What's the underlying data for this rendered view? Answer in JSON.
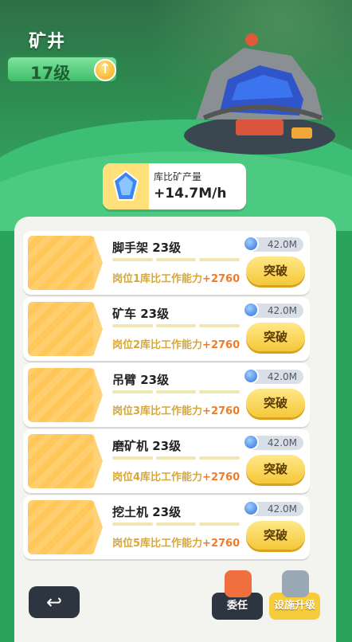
{
  "header": {
    "title": "矿井",
    "level": "17级"
  },
  "output": {
    "label": "库比矿产量",
    "value": "+14.7M/h"
  },
  "items": [
    {
      "name": "脚手架 23级",
      "desc_prefix": "岗位1库比工作能力",
      "bonus": "+2760",
      "cost": "42.0M",
      "button": "突破"
    },
    {
      "name": "矿车 23级",
      "desc_prefix": "岗位2库比工作能力",
      "bonus": "+2760",
      "cost": "42.0M",
      "button": "突破"
    },
    {
      "name": "吊臂 23级",
      "desc_prefix": "岗位3库比工作能力",
      "bonus": "+2760",
      "cost": "42.0M",
      "button": "突破"
    },
    {
      "name": "磨矿机 23级",
      "desc_prefix": "岗位4库比工作能力",
      "bonus": "+2760",
      "cost": "42.0M",
      "button": "突破"
    },
    {
      "name": "挖土机 23级",
      "desc_prefix": "岗位5库比工作能力",
      "bonus": "+2760",
      "cost": "42.0M",
      "button": "突破"
    }
  ],
  "bottom": {
    "entrust_label": "委任",
    "upgrade_label": "设施升级"
  },
  "colors": {
    "background": "#2aa35b",
    "accent": "#f5c83a",
    "bonus": "#ef7b2b",
    "dark_button": "#2d3540"
  },
  "icons": {
    "level_up": "up-arrow-icon",
    "gem": "blue-gem-icon",
    "back": "return-arrow-icon"
  }
}
